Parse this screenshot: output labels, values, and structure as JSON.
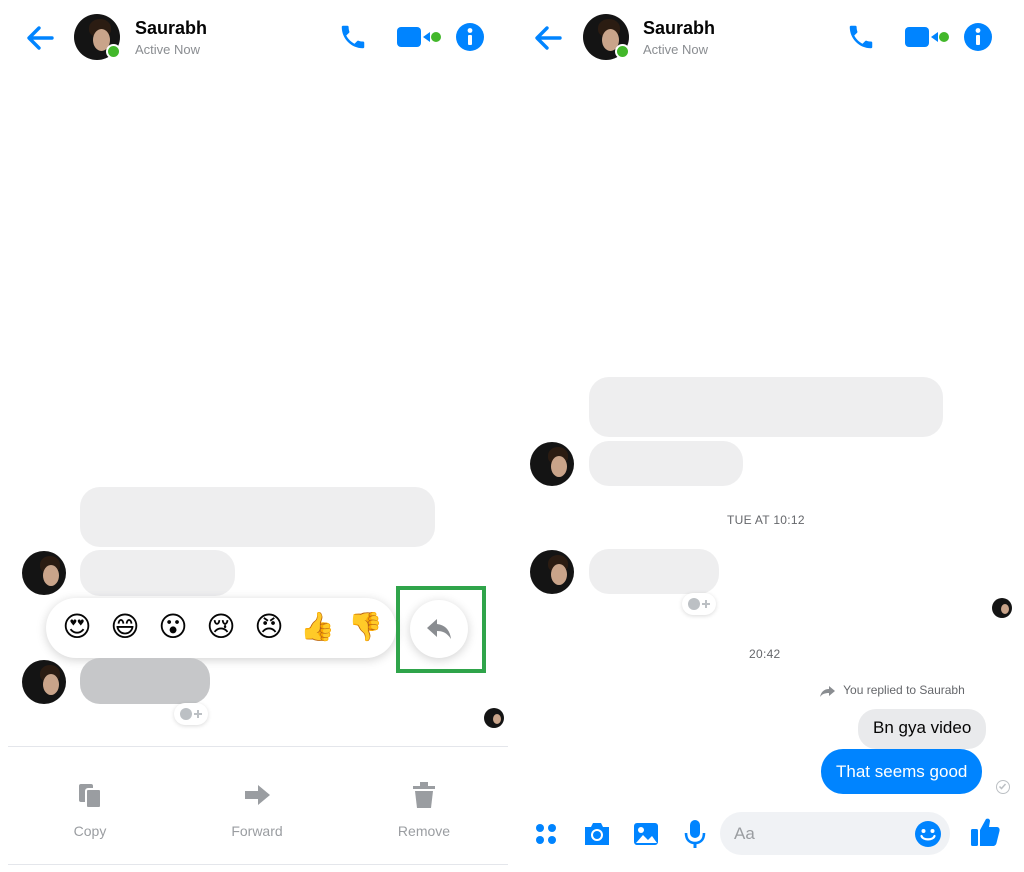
{
  "colors": {
    "accent": "#0084ff",
    "online": "#42b72a",
    "highlight": "#2fa44a",
    "bubble_grey": "#eeeeef",
    "muted_text": "#8a8d91"
  },
  "left_screen": {
    "header": {
      "contact_name": "Saurabh",
      "status": "Active Now",
      "icons": [
        "back-arrow-icon",
        "phone-icon",
        "video-camera-icon",
        "info-icon"
      ]
    },
    "reaction_bar": {
      "emojis": [
        "😍",
        "😄",
        "😮",
        "😢",
        "😠",
        "👍",
        "👎"
      ],
      "reply_icon": "reply-arrow-icon"
    },
    "actions": [
      {
        "label": "Copy",
        "icon": "copy-icon"
      },
      {
        "label": "Forward",
        "icon": "forward-arrow-icon"
      },
      {
        "label": "Remove",
        "icon": "trash-icon"
      }
    ]
  },
  "right_screen": {
    "header": {
      "contact_name": "Saurabh",
      "status": "Active Now"
    },
    "timestamps": [
      "TUE AT 10:12",
      "20:42"
    ],
    "reply_note": "You replied to Saurabh",
    "quoted_message": "Bn gya video",
    "sent_message": "That seems good",
    "composer": {
      "placeholder": "Aa",
      "icons": [
        "apps-grid-icon",
        "camera-icon",
        "gallery-icon",
        "microphone-icon",
        "emoji-icon",
        "thumbs-up-icon"
      ]
    }
  }
}
